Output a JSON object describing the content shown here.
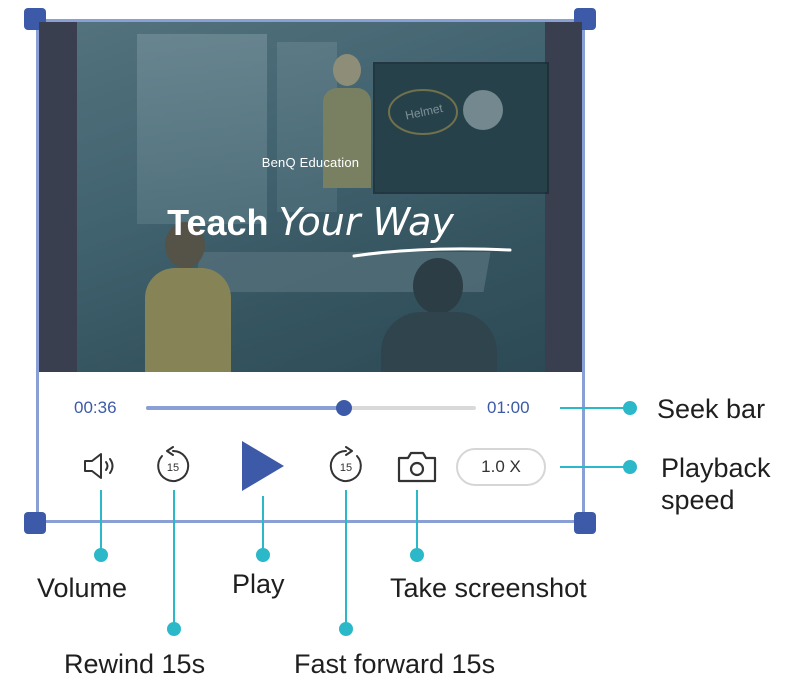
{
  "video": {
    "brand": "BenQ Education",
    "headline_bold": "Teach",
    "headline_script": "Your Way",
    "board_text": "Helmet"
  },
  "player": {
    "current_time": "00:36",
    "total_time": "01:00",
    "progress_fraction": 0.6,
    "rewind_seconds": "15",
    "forward_seconds": "15",
    "speed": "1.0 X"
  },
  "callouts": {
    "seek_bar": "Seek bar",
    "playback_speed_line1": "Playback",
    "playback_speed_line2": "speed",
    "volume": "Volume",
    "play": "Play",
    "take_screenshot": "Take screenshot",
    "rewind": "Rewind 15s",
    "fast_forward": "Fast forward 15s"
  },
  "colors": {
    "frame": "#8a9fd6",
    "handle": "#3d5aa8",
    "accent": "#3d5aa8",
    "callout": "#2bb8c8"
  },
  "icons": [
    "volume-icon",
    "rewind-15-icon",
    "play-icon",
    "forward-15-icon",
    "camera-icon"
  ]
}
